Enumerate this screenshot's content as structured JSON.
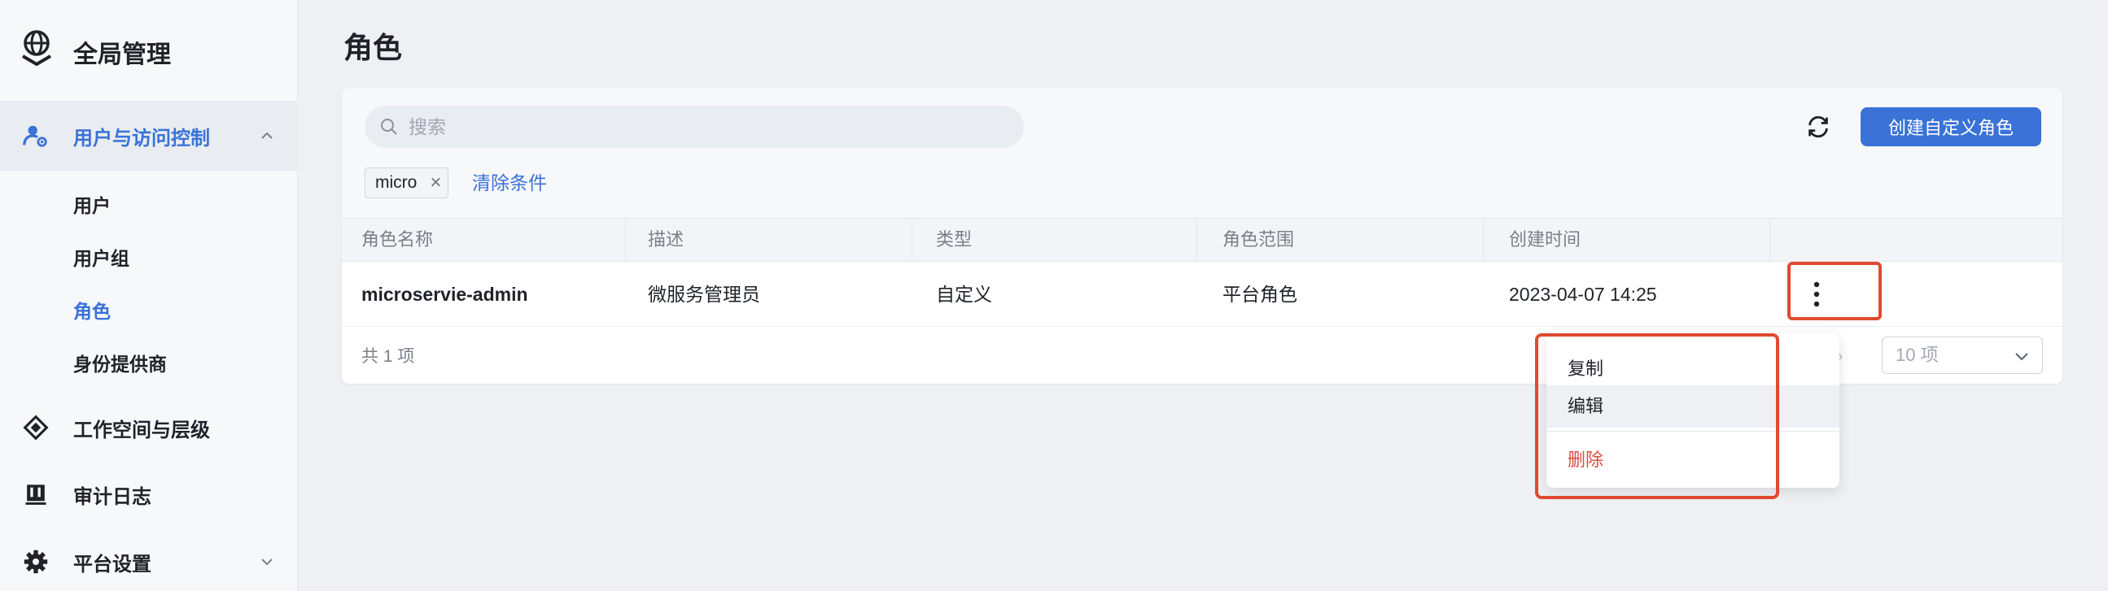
{
  "sidebar": {
    "brand_title": "全局管理",
    "groups": [
      {
        "label": "用户与访问控制",
        "icon": "user-access-icon",
        "expanded": true,
        "children": [
          "用户",
          "用户组",
          "角色",
          "身份提供商"
        ]
      },
      {
        "label": "工作空间与层级",
        "icon": "workspace-icon"
      },
      {
        "label": "审计日志",
        "icon": "audit-icon"
      },
      {
        "label": "平台设置",
        "icon": "gear-icon"
      }
    ]
  },
  "main": {
    "page_title": "角色",
    "search_placeholder": "搜索",
    "filter_tag": "micro",
    "clear_filters": "清除条件",
    "create_button": "创建自定义角色",
    "columns": [
      "角色名称",
      "描述",
      "类型",
      "角色范围",
      "创建时间"
    ],
    "rows": [
      {
        "name": "microservie-admin",
        "description": "微服务管理员",
        "type": "自定义",
        "scope": "平台角色",
        "created": "2023-04-07 14:25"
      }
    ],
    "total": "共 1 项",
    "page_size": "10 项"
  },
  "row_menu": {
    "items": [
      "复制",
      "编辑",
      "删除"
    ]
  },
  "colors": {
    "accent": "#3a72d8",
    "danger": "#e04a3f",
    "annotation": "#e04a2f"
  }
}
